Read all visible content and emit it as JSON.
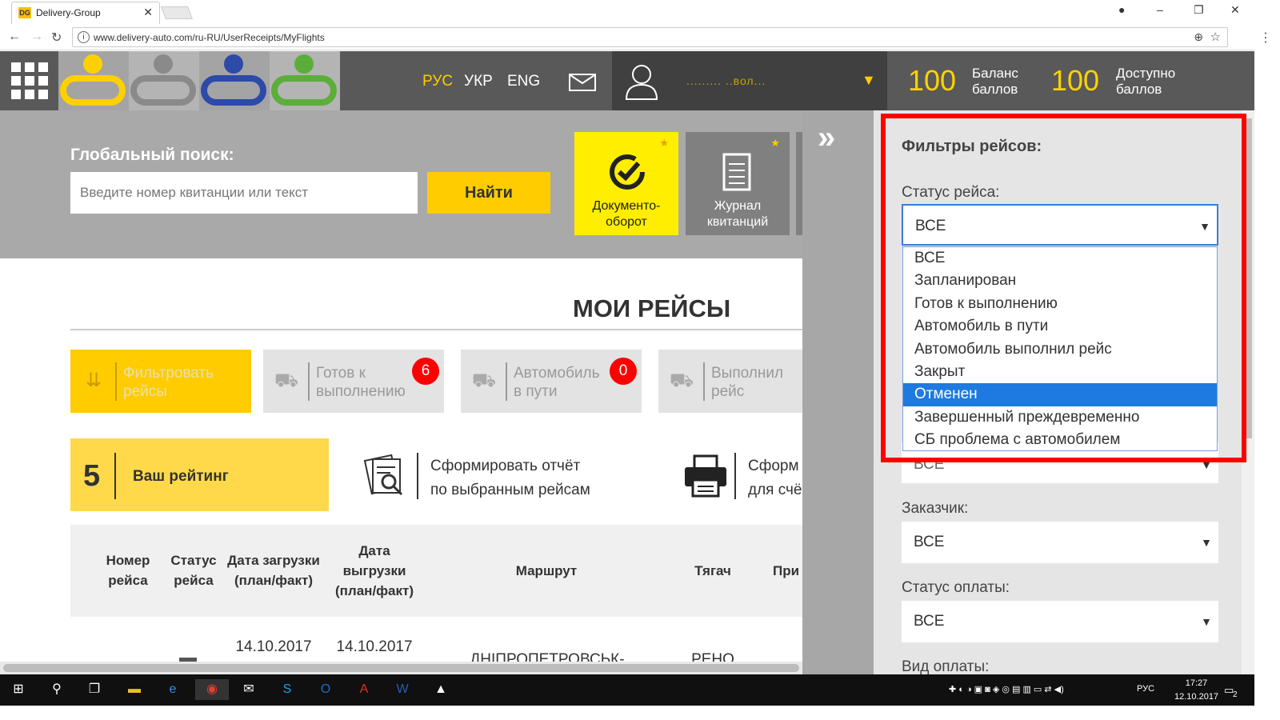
{
  "browser": {
    "tab_title": "Delivery-Group",
    "favicon_text": "DG",
    "url": "www.delivery-auto.com/ru-RU/UserReceipts/MyFlights"
  },
  "header": {
    "languages": [
      "РУС",
      "УКР",
      "ENG"
    ],
    "active_language": "РУС",
    "username": "......... ..вол...",
    "balance_value": "100",
    "balance_label_1": "Баланс",
    "balance_label_2": "баллов",
    "available_value": "100",
    "available_label_1": "Доступно",
    "available_label_2": "баллов"
  },
  "search": {
    "title": "Глобальный поиск:",
    "placeholder": "Введите номер квитанции или текст",
    "button": "Найти"
  },
  "tiles": [
    {
      "label_1": "Документо-",
      "label_2": "оборот"
    },
    {
      "label_1": "Журнал",
      "label_2": "квитанций"
    }
  ],
  "page_title": "МОИ РЕЙСЫ",
  "filter_buttons": [
    {
      "line1": "Фильтровать",
      "line2": "рейсы"
    },
    {
      "line1": "Готов к",
      "line2": "выполнению",
      "count": "6"
    },
    {
      "line1": "Автомобиль",
      "line2": "в пути",
      "count": "0"
    },
    {
      "line1": "Выполнил",
      "line2": "рейс"
    }
  ],
  "rating": {
    "value": "5",
    "label": "Ваш рейтинг"
  },
  "actions": [
    {
      "line1": "Сформировать отчёт",
      "line2": "по выбранным рейсам"
    },
    {
      "line1": "Сформ",
      "line2": "для счё"
    }
  ],
  "table": {
    "headers": [
      {
        "l1": "Номер",
        "l2": "рейса"
      },
      {
        "l1": "Статус",
        "l2": "рейса"
      },
      {
        "l1": "Дата загрузки",
        "l2": "(план/факт)"
      },
      {
        "l1": "Дата",
        "l2": "выгрузки",
        "l3": "(план/факт)"
      },
      {
        "l1": "Маршрут"
      },
      {
        "l1": "Тягач"
      },
      {
        "l1": "При"
      }
    ],
    "row1": {
      "load_date": "14.10.2017",
      "unload_date": "14.10.2017",
      "route": "ДНІПРОПЕТРОВСЬК-",
      "tractor": "РЕНО"
    }
  },
  "filters_panel": {
    "title": "Фильтры рейсов:",
    "status_label": "Статус рейса:",
    "status_value": "ВСЕ",
    "status_options": [
      "ВСЕ",
      "Запланирован",
      "Готов к выполнению",
      "Автомобиль в пути",
      "Автомобиль выполнил рейс",
      "Закрыт",
      "Отменен",
      "Завершенный преждевременно",
      "СБ проблема с автомобилем"
    ],
    "highlighted_option": "Отменен",
    "hidden_select_value": "ВСЕ",
    "customer_label": "Заказчик:",
    "customer_value": "ВСЕ",
    "payment_status_label": "Статус оплаты:",
    "payment_status_value": "ВСЕ",
    "payment_type_label": "Вид оплаты:"
  },
  "taskbar": {
    "language": "РУС",
    "time": "17:27",
    "date": "12.10.2017",
    "notifications": "2"
  },
  "colors": {
    "accent_yellow": "#ffcc00",
    "header_grey": "#595959",
    "highlight_red": "#ff0000",
    "selection_blue": "#1e7ae0"
  }
}
